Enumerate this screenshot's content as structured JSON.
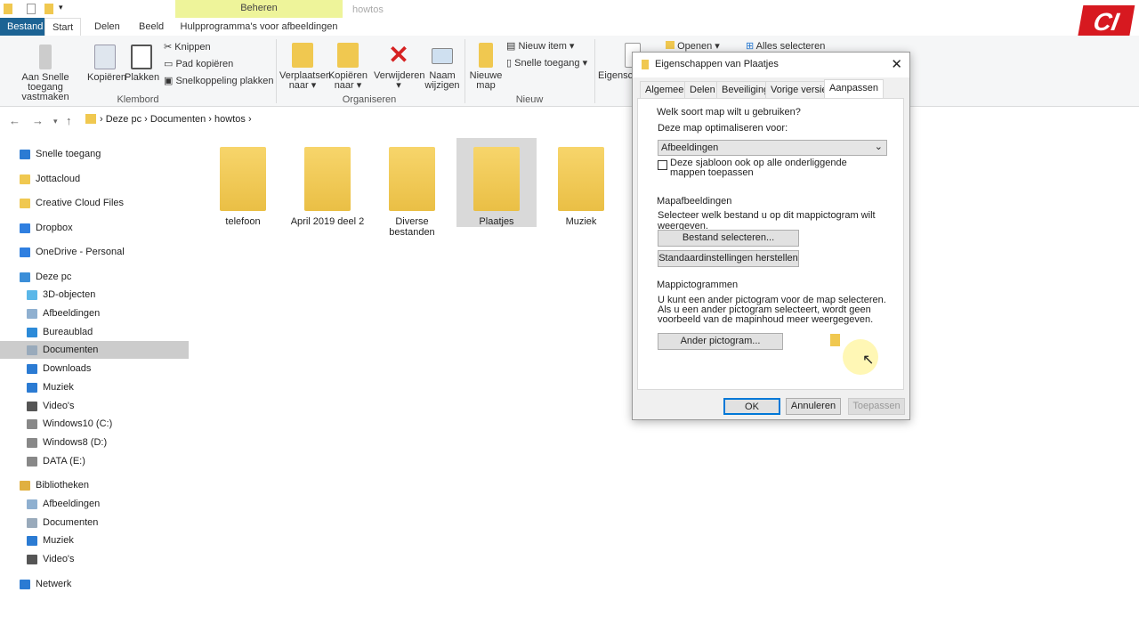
{
  "window": {
    "title": "howtos",
    "context_header": "Beheren",
    "context_tab": "Hulpprogramma's voor afbeeldingen"
  },
  "tabs": [
    "Bestand",
    "Start",
    "Delen",
    "Beeld"
  ],
  "ribbon": {
    "pin": "Aan Snelle toegang vastmaken",
    "copy": "Kopiëren",
    "paste": "Plakken",
    "cut": "Knippen",
    "copy_path": "Pad kopiëren",
    "paste_shortcut": "Snelkoppeling plakken",
    "group_clipboard": "Klembord",
    "move_to": "Verplaatsen naar",
    "copy_to": "Kopiëren naar",
    "delete": "Verwijderen",
    "rename": "Naam wijzigen",
    "group_organize": "Organiseren",
    "new_folder": "Nieuwe map",
    "new_item": "Nieuw item",
    "easy_access": "Snelle toegang",
    "group_new": "Nieuw",
    "properties": "Eigensch",
    "open": "Openen",
    "select_all": "Alles selecteren"
  },
  "breadcrumb": [
    "Deze pc",
    "Documenten",
    "howtos"
  ],
  "sidebar": [
    {
      "label": "Snelle toegang",
      "color": "#2b7bd3",
      "indent": 0
    },
    {
      "label": "Jottacloud",
      "color": "#f0c850",
      "indent": 0
    },
    {
      "label": "Creative Cloud Files",
      "color": "#f0c850",
      "indent": 0
    },
    {
      "label": "Dropbox",
      "color": "#2f7fe0",
      "indent": 0
    },
    {
      "label": "OneDrive - Personal",
      "color": "#2f7fe0",
      "indent": 0
    },
    {
      "label": "Deze pc",
      "color": "#3b8ed8",
      "indent": 0
    },
    {
      "label": "3D-objecten",
      "color": "#5bb7e8",
      "indent": 1
    },
    {
      "label": "Afbeeldingen",
      "color": "#8fb0d0",
      "indent": 1
    },
    {
      "label": "Bureaublad",
      "color": "#2c8ad8",
      "indent": 1
    },
    {
      "label": "Documenten",
      "color": "#9ab",
      "indent": 1,
      "selected": true
    },
    {
      "label": "Downloads",
      "color": "#2b7bd3",
      "indent": 1
    },
    {
      "label": "Muziek",
      "color": "#2b7bd3",
      "indent": 1
    },
    {
      "label": "Video's",
      "color": "#555",
      "indent": 1
    },
    {
      "label": "Windows10 (C:)",
      "color": "#888",
      "indent": 1
    },
    {
      "label": "Windows8 (D:)",
      "color": "#888",
      "indent": 1
    },
    {
      "label": "DATA (E:)",
      "color": "#888",
      "indent": 1
    },
    {
      "label": "Bibliotheken",
      "color": "#e0b040",
      "indent": 0
    },
    {
      "label": "Afbeeldingen",
      "color": "#8fb0d0",
      "indent": 1
    },
    {
      "label": "Documenten",
      "color": "#9ab",
      "indent": 1
    },
    {
      "label": "Muziek",
      "color": "#2b7bd3",
      "indent": 1
    },
    {
      "label": "Video's",
      "color": "#555",
      "indent": 1
    },
    {
      "label": "Netwerk",
      "color": "#2b7bd3",
      "indent": 0
    }
  ],
  "folders": [
    {
      "name": "telefoon"
    },
    {
      "name": "April 2019 deel 2"
    },
    {
      "name": "Diverse bestanden"
    },
    {
      "name": "Plaatjes",
      "selected": true
    },
    {
      "name": "Muziek"
    }
  ],
  "dialog": {
    "title": "Eigenschappen van Plaatjes",
    "tabs": [
      "Algemeen",
      "Delen",
      "Beveiliging",
      "Vorige versies",
      "Aanpassen"
    ],
    "q": "Welk soort map wilt u gebruiken?",
    "optimize_label": "Deze map optimaliseren voor:",
    "optimize_value": "Afbeeldingen",
    "subfolders_checkbox": "Deze sjabloon ook op alle onderliggende mappen toepassen",
    "folder_pics_title": "Mapafbeeldingen",
    "folder_pics_desc": "Selecteer welk bestand u op dit mappictogram wilt weergeven.",
    "choose_file": "Bestand selecteren...",
    "restore_default": "Standaardinstellingen herstellen",
    "icons_title": "Mappictogrammen",
    "icons_desc": "U kunt een ander pictogram voor de map selecteren. Als u een ander pictogram selecteert, wordt geen voorbeeld van de mapinhoud meer weergegeven.",
    "change_icon": "Ander pictogram...",
    "ok": "OK",
    "cancel": "Annuleren",
    "apply": "Toepassen"
  },
  "logo": "CI"
}
